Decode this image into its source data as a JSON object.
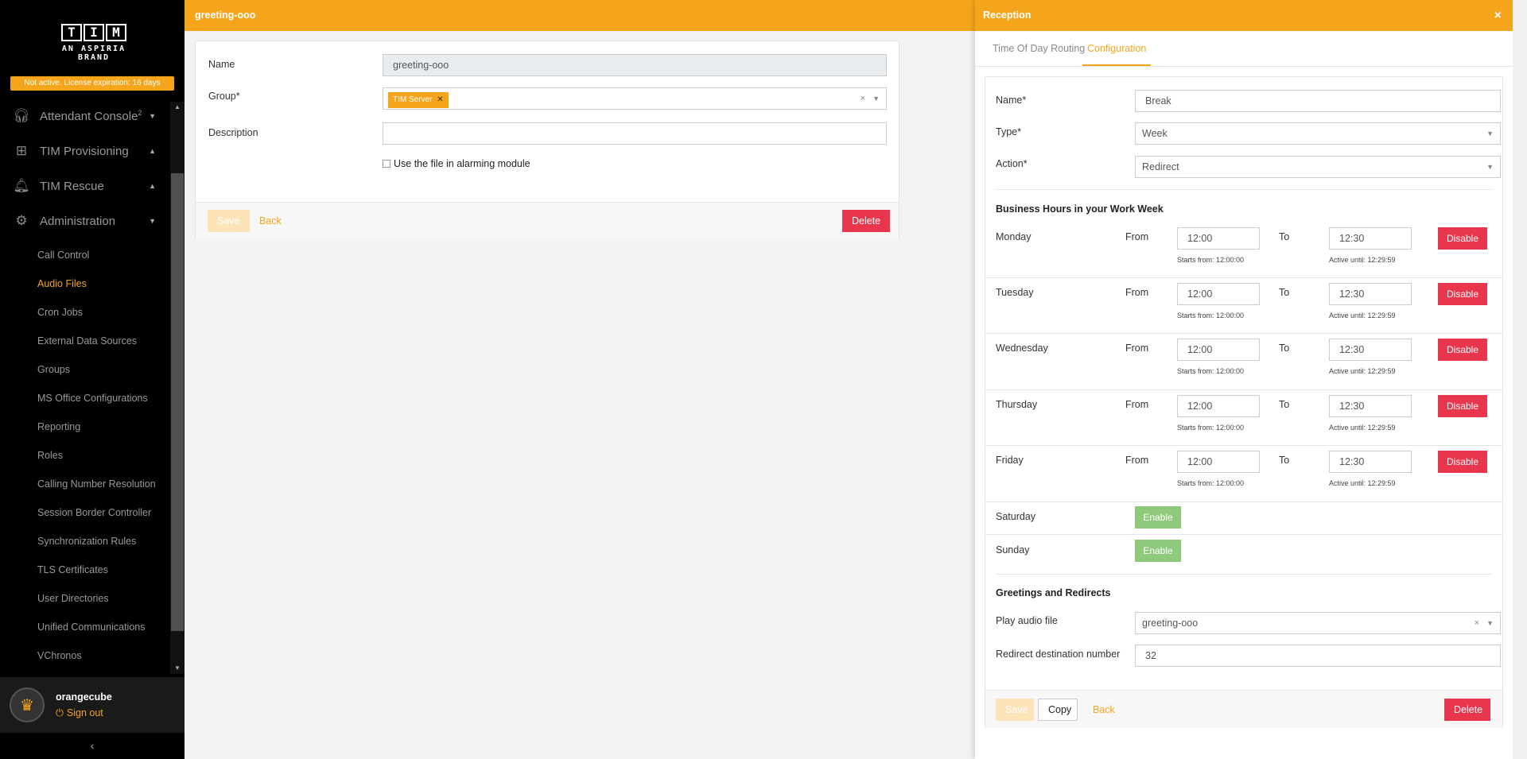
{
  "sidebar": {
    "logo_letters": [
      "T",
      "I",
      "M"
    ],
    "logo_sub": "AN ASPIRIA BRAND",
    "license": "Not active. License expiration: 16 days",
    "main": [
      {
        "label": "Attendant Console",
        "sup": "2",
        "icon": "headset-icon",
        "chevron": "▼"
      },
      {
        "label": "TIM Provisioning",
        "icon": "plus-box-icon",
        "chevron": "▲"
      },
      {
        "label": "TIM Rescue",
        "icon": "alarm-light-icon",
        "chevron": "▲"
      },
      {
        "label": "Administration",
        "icon": "gear-icon",
        "chevron": "▼"
      }
    ],
    "sub": [
      "Call Control",
      "Audio Files",
      "Cron Jobs",
      "External Data Sources",
      "Groups",
      "MS Office Configurations",
      "Reporting",
      "Roles",
      "Calling Number Resolution",
      "Session Border Controller",
      "Synchronization Rules",
      "TLS Certificates",
      "User Directories",
      "Unified Communications",
      "VChronos"
    ],
    "active_sub": "Audio Files",
    "user": {
      "name": "orangecube",
      "signout": "Sign out"
    },
    "collapse": "‹"
  },
  "main": {
    "title": "greeting-ooo",
    "name_label": "Name",
    "name_value": "greeting-ooo",
    "group_label": "Group*",
    "group_chip": "TIM Server",
    "description_label": "Description",
    "description_value": "",
    "alarm_label": "Use the file in alarming module",
    "save": "Save",
    "back": "Back",
    "delete": "Delete"
  },
  "panel": {
    "title": "Reception",
    "close": "×",
    "tabs": [
      "Time Of Day Routing",
      "Configuration"
    ],
    "active_tab": "Configuration",
    "name_label": "Name*",
    "name_value": "Break",
    "type_label": "Type*",
    "type_value": "Week",
    "action_label": "Action*",
    "action_value": "Redirect",
    "business_heading": "Business Hours in your Work Week",
    "from_label": "From",
    "to_label": "To",
    "days": [
      {
        "day": "Monday",
        "from": "12:00",
        "to": "12:30",
        "starts": "Starts from: 12:00:00",
        "until": "Active until: 12:29:59",
        "button": "Disable"
      },
      {
        "day": "Tuesday",
        "from": "12:00",
        "to": "12:30",
        "starts": "Starts from: 12:00:00",
        "until": "Active until: 12:29:59",
        "button": "Disable"
      },
      {
        "day": "Wednesday",
        "from": "12:00",
        "to": "12:30",
        "starts": "Starts from: 12:00:00",
        "until": "Active until: 12:29:59",
        "button": "Disable"
      },
      {
        "day": "Thursday",
        "from": "12:00",
        "to": "12:30",
        "starts": "Starts from: 12:00:00",
        "until": "Active until: 12:29:59",
        "button": "Disable"
      },
      {
        "day": "Friday",
        "from": "12:00",
        "to": "12:30",
        "starts": "Starts from: 12:00:00",
        "until": "Active until: 12:29:59",
        "button": "Disable"
      }
    ],
    "weekend": [
      {
        "day": "Saturday",
        "button": "Enable"
      },
      {
        "day": "Sunday",
        "button": "Enable"
      }
    ],
    "greetings_heading": "Greetings and Redirects",
    "audio_label": "Play audio file",
    "audio_value": "greeting-ooo",
    "redirect_label": "Redirect destination number",
    "redirect_value": "32",
    "save": "Save",
    "copy": "Copy",
    "back": "Back",
    "delete": "Delete"
  },
  "colors": {
    "accent": "#f5a51b",
    "danger": "#e8364d",
    "enable": "#8fc97b"
  }
}
